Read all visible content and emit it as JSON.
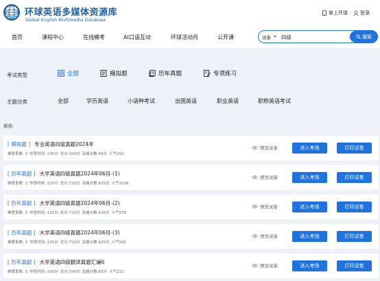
{
  "brand": {
    "name_cn": "环球英语多媒体资源库",
    "name_en": "Global English Multimedia Database"
  },
  "header_links": {
    "app": "掌上环球",
    "login": "登录"
  },
  "nav": [
    "首页",
    "课程中心",
    "在线模考",
    "AI口语互动",
    "环球活动月",
    "公开课"
  ],
  "search": {
    "type": "试卷",
    "value": "四级",
    "button": "搜索"
  },
  "filters": {
    "type_label": "考试类型",
    "types": [
      "全部",
      "模拟题",
      "历年真题",
      "专项练习"
    ],
    "category_label": "主题分类",
    "categories": [
      "全部",
      "学历英语",
      "小语种考试",
      "出国英语",
      "职业英语",
      "职称英语考试"
    ]
  },
  "sort_label": "排序:",
  "card_labels": {
    "preview": "预览试卷",
    "enter": "进入考场",
    "print": "打印试卷"
  },
  "papers": [
    {
      "tag": "[ 模拟题 ]",
      "title": "专业英语四级真题2024年",
      "difficulty": "难度系数: 3",
      "time": "作答时间: 130分",
      "total": "总分:100分",
      "pass": "及格分数:60分",
      "popularity": "人气292"
    },
    {
      "tag": "[ 历年真题 ]",
      "title": "大学英语四级真题2024年06月-(1)",
      "difficulty": "难度系数: 3",
      "time": "作答时间: 125分",
      "total": "总分:710分",
      "pass": "及格分数:425分",
      "popularity": "人气1238"
    },
    {
      "tag": "[ 历年真题 ]",
      "title": "大学英语四级真题2024年06月-(2)",
      "difficulty": "难度系数: 3",
      "time": "作答时间: 125分",
      "total": "总分:710分",
      "pass": "及格分数:425分",
      "popularity": "人气578"
    },
    {
      "tag": "[ 历年真题 ]",
      "title": "大学英语四级真题2024年06月-(3)",
      "difficulty": "难度系数: 3",
      "time": "作答时间: 125分",
      "total": "总分:710分",
      "pass": "及格分数:425分",
      "popularity": "人气545"
    },
    {
      "tag": "[ 历年真题 ]",
      "title": "大学英语四级翻译真题汇编6",
      "difficulty": "难度系数: 3",
      "time": "作答时间: 100分",
      "total": "总分:100分",
      "pass": "及格分数:60分",
      "popularity": "人气232"
    }
  ],
  "colors": {
    "accent": "#1f73e0",
    "brand": "#1f5fa8",
    "background": "#eef1f7"
  }
}
